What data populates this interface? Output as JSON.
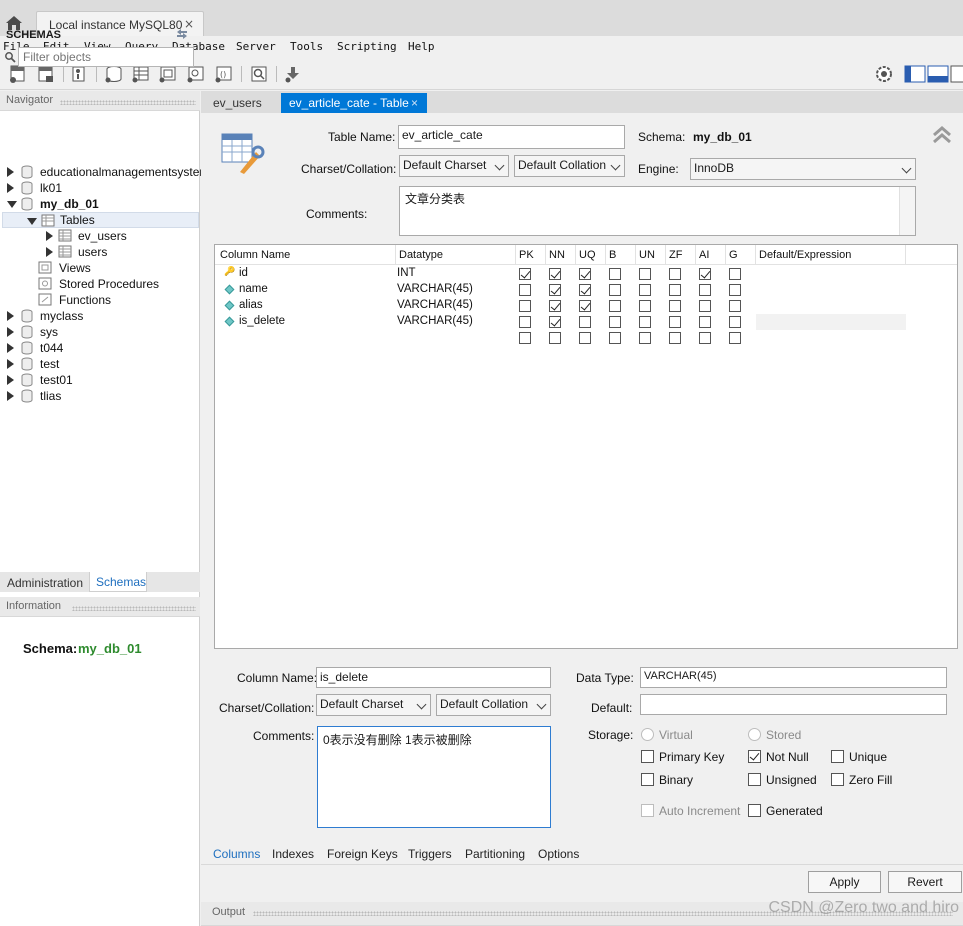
{
  "app": {
    "instance_tab": "Local instance MySQL80",
    "instance_tab_close": "×"
  },
  "menu": [
    "File",
    "Edit",
    "View",
    "Query",
    "Database",
    "Server",
    "Tools",
    "Scripting",
    "Help"
  ],
  "navigator": {
    "header": "Navigator",
    "schemas_title": "SCHEMAS",
    "filter_placeholder": "Filter objects",
    "tree": {
      "schema_1": "educationalmanagementsystem",
      "schema_2": "lk01",
      "schema_3": "my_db_01",
      "tables": "Tables",
      "table_1": "ev_users",
      "table_2": "users",
      "views": "Views",
      "procedures": "Stored Procedures",
      "functions": "Functions",
      "schema_4": "myclass",
      "schema_5": "sys",
      "schema_6": "t044",
      "schema_7": "test",
      "schema_8": "test01",
      "schema_9": "tlias"
    },
    "tabs": {
      "administration": "Administration",
      "schemas": "Schemas"
    },
    "info_header": "Information",
    "info_schema_label": "Schema:",
    "info_schema_value": "my_db_01"
  },
  "editor_tabs": {
    "tab_1": "ev_users",
    "tab_2": "ev_article_cate - Table",
    "tab_2_close": "×"
  },
  "table_editor": {
    "table_name_label": "Table Name:",
    "table_name_value": "ev_article_cate",
    "schema_label": "Schema:",
    "schema_value": "my_db_01",
    "charset_label": "Charset/Collation:",
    "charset_value": "Default Charset",
    "collation_value": "Default Collation",
    "engine_label": "Engine:",
    "engine_value": "InnoDB",
    "comments_label": "Comments:",
    "comments_value": "文章分类表"
  },
  "columns_grid": {
    "headers": [
      "Column Name",
      "Datatype",
      "PK",
      "NN",
      "UQ",
      "B",
      "UN",
      "ZF",
      "AI",
      "G",
      "Default/Expression"
    ],
    "rows": [
      {
        "name": "id",
        "type": "INT",
        "flags": [
          true,
          true,
          true,
          false,
          false,
          false,
          true,
          false
        ]
      },
      {
        "name": "name",
        "type": "VARCHAR(45)",
        "flags": [
          false,
          true,
          true,
          false,
          false,
          false,
          false,
          false
        ]
      },
      {
        "name": "alias",
        "type": "VARCHAR(45)",
        "flags": [
          false,
          true,
          true,
          false,
          false,
          false,
          false,
          false
        ]
      },
      {
        "name": "is_delete",
        "type": "VARCHAR(45)",
        "flags": [
          false,
          true,
          false,
          false,
          false,
          false,
          false,
          false
        ]
      }
    ]
  },
  "column_detail": {
    "column_name_label": "Column Name:",
    "column_name_value": "is_delete",
    "charset_label": "Charset/Collation:",
    "charset_value": "Default Charset",
    "collation_value": "Default Collation",
    "comments_label": "Comments:",
    "comments_value": "0表示没有删除 1表示被删除",
    "data_type_label": "Data Type:",
    "data_type_value": "VARCHAR(45)",
    "default_label": "Default:",
    "default_value": "",
    "storage_label": "Storage:",
    "virtual": "Virtual",
    "stored": "Stored",
    "primary_key": "Primary Key",
    "not_null": "Not Null",
    "unique": "Unique",
    "binary": "Binary",
    "unsigned": "Unsigned",
    "zero_fill": "Zero Fill",
    "auto_increment": "Auto Increment",
    "generated": "Generated"
  },
  "bottom_tabs": [
    "Columns",
    "Indexes",
    "Foreign Keys",
    "Triggers",
    "Partitioning",
    "Options"
  ],
  "buttons": {
    "apply": "Apply",
    "revert": "Revert"
  },
  "output_label": "Output",
  "watermark": "CSDN @Zero two and hiro",
  "colors": {
    "accent": "#0078d7",
    "schema_green": "#2e8b2e"
  }
}
